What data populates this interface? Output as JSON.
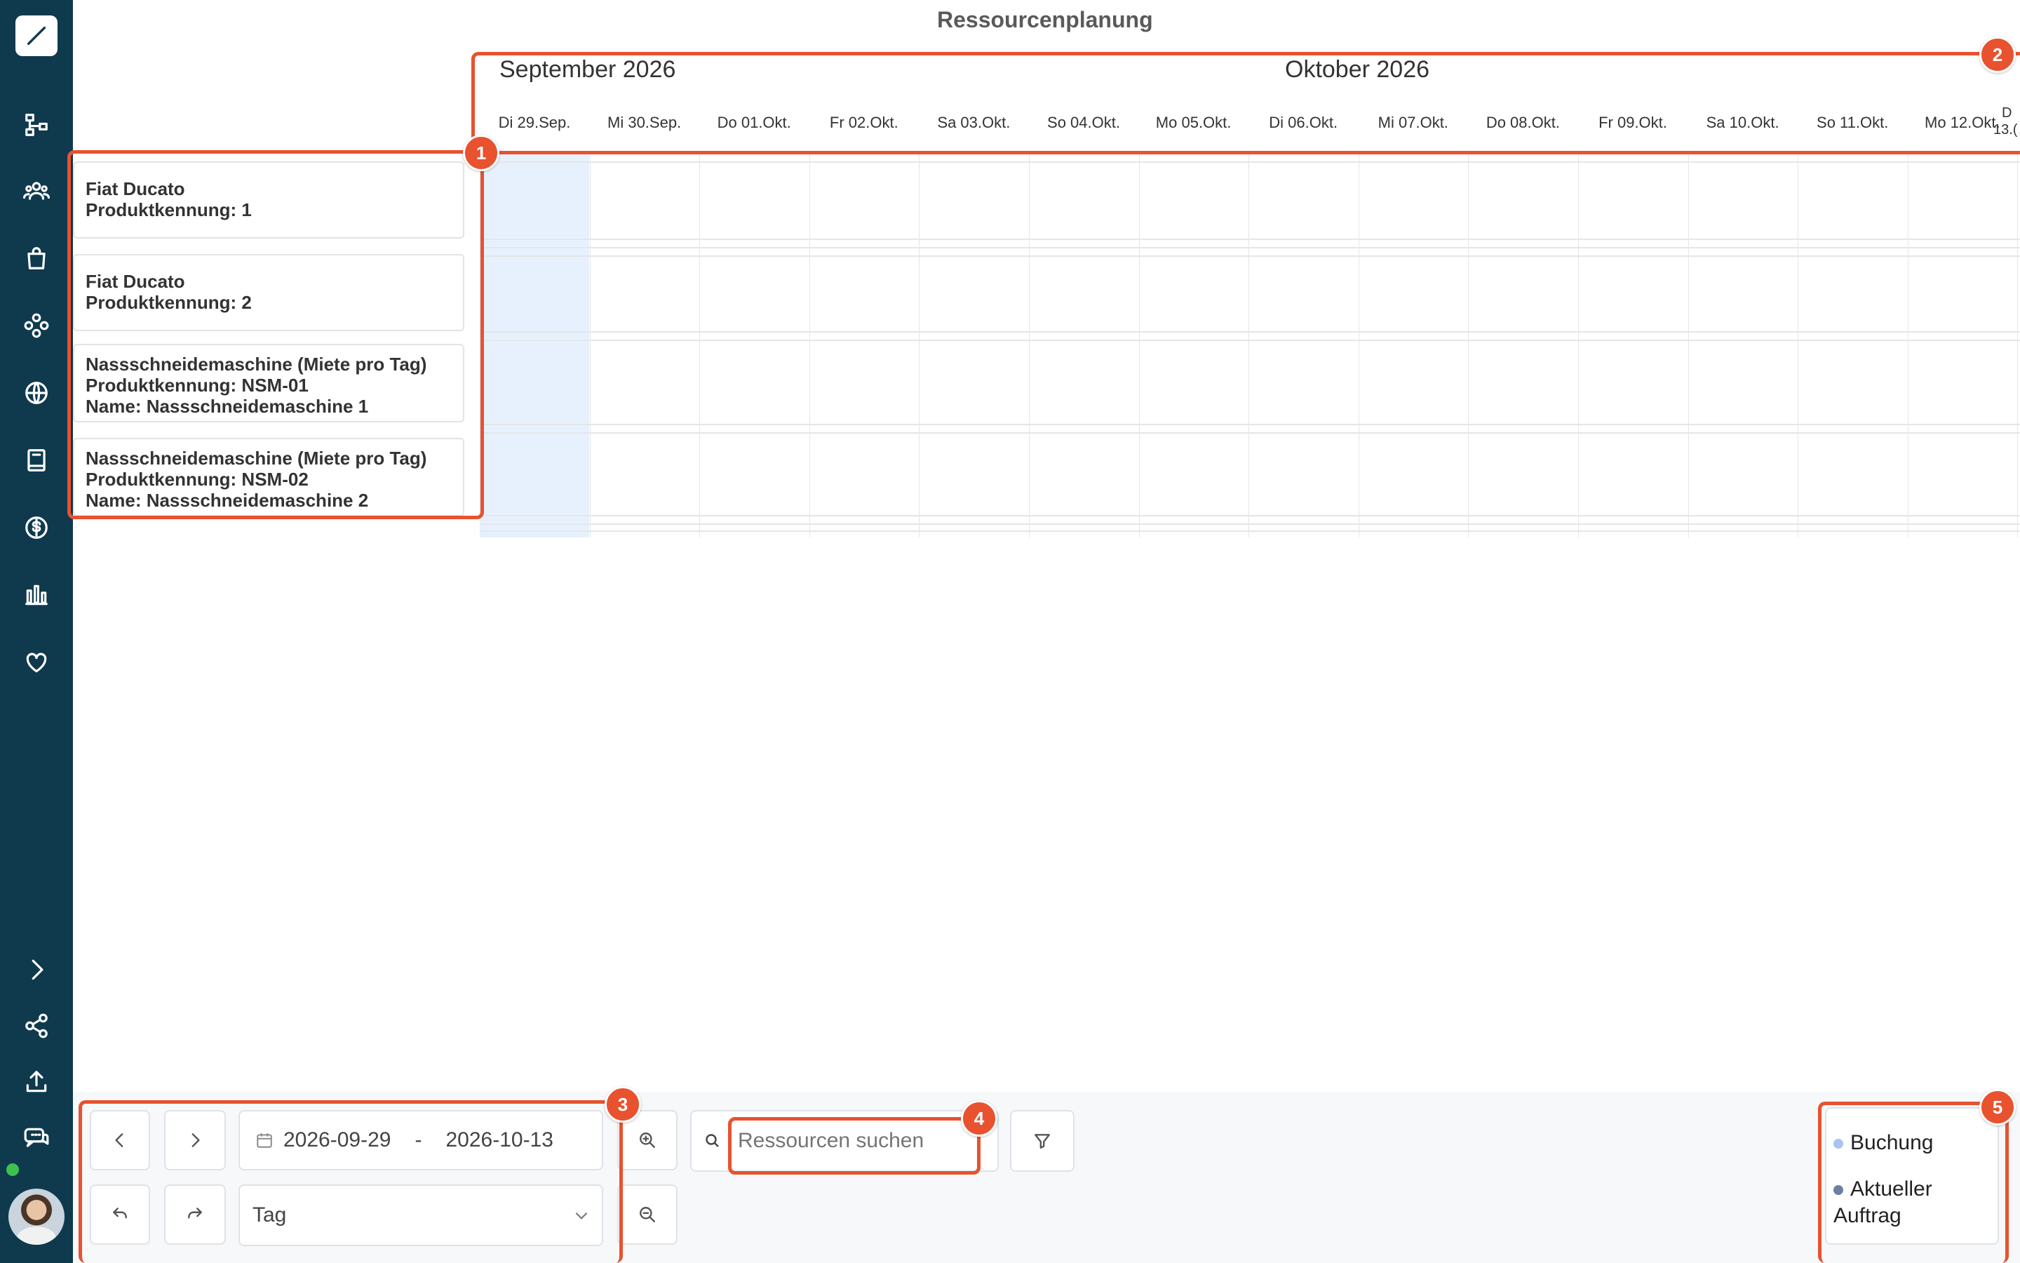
{
  "app": {
    "title": "Ressourcenplanung"
  },
  "sidebar": {
    "icons": [
      "structure-icon",
      "team-icon",
      "shopping-bag-icon",
      "network-icon",
      "globe-icon",
      "book-icon",
      "dollar-icon",
      "bar-chart-icon",
      "heart-icon"
    ],
    "bottom_icons": [
      "chevron-right-icon",
      "share-icon",
      "upload-icon",
      "chat-icon"
    ]
  },
  "timeline": {
    "months": [
      "September 2026",
      "Oktober 2026"
    ],
    "days": [
      "Di 29.Sep.",
      "Mi 30.Sep.",
      "Do 01.Okt.",
      "Fr 02.Okt.",
      "Sa 03.Okt.",
      "So 04.Okt.",
      "Mo 05.Okt.",
      "Di 06.Okt.",
      "Mi 07.Okt.",
      "Do 08.Okt.",
      "Fr 09.Okt.",
      "Sa 10.Okt.",
      "So 11.Okt.",
      "Mo 12.Okt."
    ],
    "partial_day_top": "D",
    "partial_day_bottom": "13.("
  },
  "resources": [
    {
      "lines": [
        "Fiat Ducato",
        "Produktkennung: 1"
      ]
    },
    {
      "lines": [
        "Fiat Ducato",
        "Produktkennung: 2"
      ]
    },
    {
      "lines": [
        "Nassschneidemaschine (Miete pro Tag)",
        "Produktkennung: NSM-01",
        "Name: Nassschneidemaschine 1"
      ]
    },
    {
      "lines": [
        "Nassschneidemaschine (Miete pro Tag)",
        "Produktkennung: NSM-02",
        "Name: Nassschneidemaschine 2"
      ]
    }
  ],
  "controls": {
    "date_from": "2026-09-29",
    "date_separator": "-",
    "date_to": "2026-10-13",
    "view_mode": "Tag",
    "search_placeholder": "Ressourcen suchen"
  },
  "legend": {
    "items": [
      {
        "label": "Buchung",
        "color": "#a9c4f0"
      },
      {
        "label": "Aktueller Auftrag",
        "color": "#6b7fa3"
      }
    ]
  },
  "annotations": [
    "1",
    "2",
    "3",
    "4",
    "5"
  ],
  "colors": {
    "accent": "#e8522f",
    "sidebar": "#0f3a4e",
    "today_column": "#e7f1fd"
  }
}
